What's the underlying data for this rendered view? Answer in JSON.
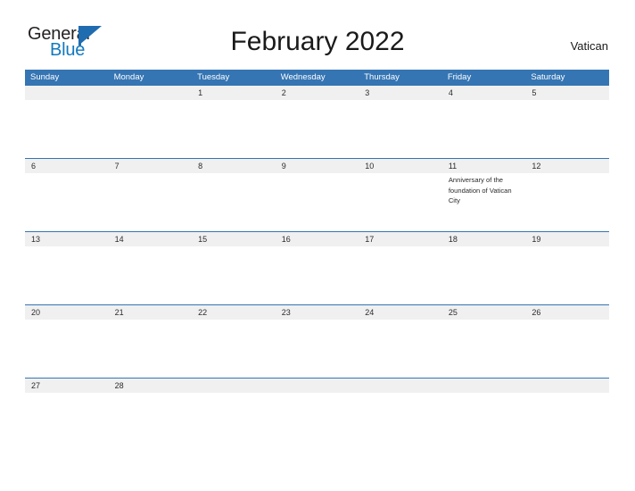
{
  "brand": {
    "name_part1": "General",
    "name_part2": "Blue",
    "logo_icon": "triangle-flag-icon",
    "color_dark": "#231f20",
    "color_blue": "#1278be",
    "triangle_color": "#1f6cb0"
  },
  "header": {
    "title": "February 2022",
    "region": "Vatican"
  },
  "calendar": {
    "accent_color": "#3575b3",
    "band_color": "#f0f0f0",
    "day_names": [
      "Sunday",
      "Monday",
      "Tuesday",
      "Wednesday",
      "Thursday",
      "Friday",
      "Saturday"
    ],
    "weeks": [
      {
        "days": [
          {
            "num": "",
            "events": []
          },
          {
            "num": "",
            "events": []
          },
          {
            "num": "1",
            "events": []
          },
          {
            "num": "2",
            "events": []
          },
          {
            "num": "3",
            "events": []
          },
          {
            "num": "4",
            "events": []
          },
          {
            "num": "5",
            "events": []
          }
        ]
      },
      {
        "days": [
          {
            "num": "6",
            "events": []
          },
          {
            "num": "7",
            "events": []
          },
          {
            "num": "8",
            "events": []
          },
          {
            "num": "9",
            "events": []
          },
          {
            "num": "10",
            "events": []
          },
          {
            "num": "11",
            "events": [
              "Anniversary of the foundation of Vatican City"
            ]
          },
          {
            "num": "12",
            "events": []
          }
        ]
      },
      {
        "days": [
          {
            "num": "13",
            "events": []
          },
          {
            "num": "14",
            "events": []
          },
          {
            "num": "15",
            "events": []
          },
          {
            "num": "16",
            "events": []
          },
          {
            "num": "17",
            "events": []
          },
          {
            "num": "18",
            "events": []
          },
          {
            "num": "19",
            "events": []
          }
        ]
      },
      {
        "days": [
          {
            "num": "20",
            "events": []
          },
          {
            "num": "21",
            "events": []
          },
          {
            "num": "22",
            "events": []
          },
          {
            "num": "23",
            "events": []
          },
          {
            "num": "24",
            "events": []
          },
          {
            "num": "25",
            "events": []
          },
          {
            "num": "26",
            "events": []
          }
        ]
      },
      {
        "days": [
          {
            "num": "27",
            "events": []
          },
          {
            "num": "28",
            "events": []
          },
          {
            "num": "",
            "events": []
          },
          {
            "num": "",
            "events": []
          },
          {
            "num": "",
            "events": []
          },
          {
            "num": "",
            "events": []
          },
          {
            "num": "",
            "events": []
          }
        ]
      }
    ]
  }
}
